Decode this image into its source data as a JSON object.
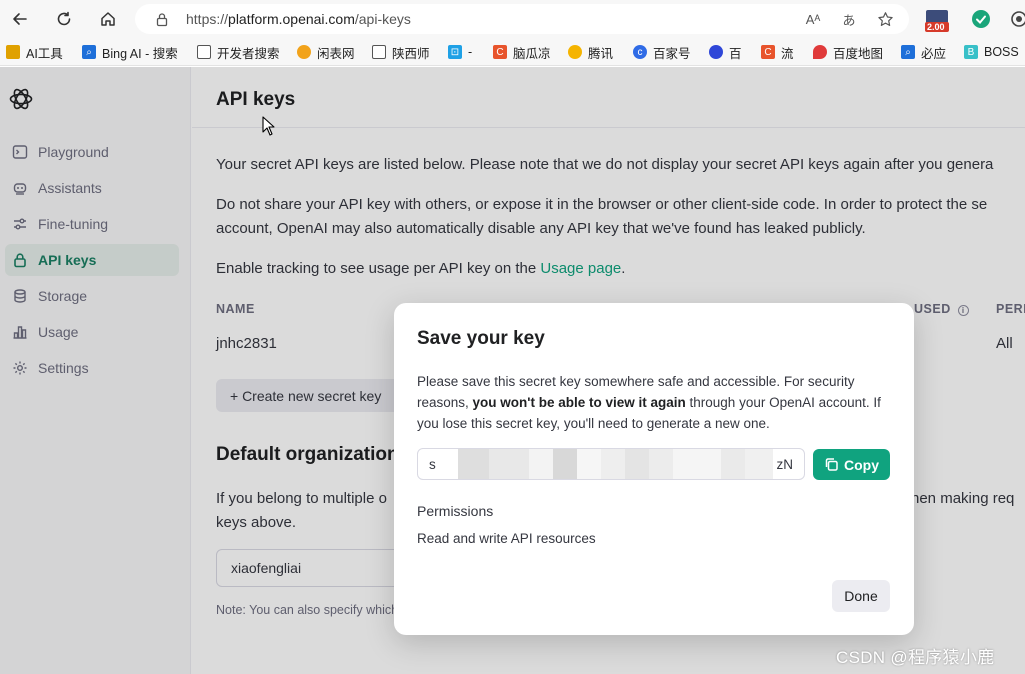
{
  "browser": {
    "url_prefix": "https://",
    "url_host": "platform.openai.com",
    "url_path": "/api-keys",
    "read_aloud": "Aᴬ",
    "translate": "あ",
    "extension_badge": "2.00",
    "bookmarks": [
      {
        "label": "AI工具",
        "color": "#e0a100",
        "icon": "folder-icon"
      },
      {
        "label": "Bing AI - 搜索",
        "color": "#1e6fd9",
        "icon": "search-icon"
      },
      {
        "label": "开发者搜索",
        "color": "#555555",
        "icon": "page-icon"
      },
      {
        "label": "闲表网",
        "color": "#f2a31b",
        "icon": "fruit-icon"
      },
      {
        "label": "陕西师",
        "color": "#555555",
        "icon": "page-icon"
      },
      {
        "label": "-",
        "color": "#1fa1e6",
        "icon": "bilibili-icon"
      },
      {
        "label": "脑瓜凉",
        "color": "#e8542c",
        "icon": "c-icon"
      },
      {
        "label": "腾讯",
        "color": "#f5b400",
        "icon": "bell-icon"
      },
      {
        "label": "百家号",
        "color": "#2f6be6",
        "icon": "baijia-icon"
      },
      {
        "label": "百",
        "color": "#2f47d8",
        "icon": "paw-icon"
      },
      {
        "label": "流",
        "color": "#e8542c",
        "icon": "c-icon"
      },
      {
        "label": "百度地图",
        "color": "#e03a3a",
        "icon": "pin-icon"
      },
      {
        "label": "必应",
        "color": "#1e6fd9",
        "icon": "search-icon"
      },
      {
        "label": "BOSS",
        "color": "#38c0c8",
        "icon": "b-icon"
      }
    ]
  },
  "sidebar": {
    "items": [
      {
        "label": "Playground",
        "icon": "terminal-icon"
      },
      {
        "label": "Assistants",
        "icon": "robot-icon"
      },
      {
        "label": "Fine-tuning",
        "icon": "sliders-icon"
      },
      {
        "label": "API keys",
        "icon": "lock-icon",
        "active": true
      },
      {
        "label": "Storage",
        "icon": "database-icon"
      },
      {
        "label": "Usage",
        "icon": "bar-chart-icon"
      },
      {
        "label": "Settings",
        "icon": "gear-icon"
      }
    ]
  },
  "main": {
    "title": "API keys",
    "intro": "Your secret API keys are listed below. Please note that we do not display your secret API keys again after you genera",
    "warning_line1": "Do not share your API key with others, or expose it in the browser or other client-side code. In order to protect the se",
    "warning_line2": "account, OpenAI may also automatically disable any API key that we've found has leaked publicly.",
    "tracking_text": "Enable tracking to see usage per API key on the ",
    "tracking_link": "Usage page",
    "tracking_end": ".",
    "table": {
      "headers": {
        "name": "NAME",
        "last_used": "USED",
        "permissions": "PERI"
      },
      "rows": [
        {
          "name": "jnhc2831",
          "last_used": "-",
          "permissions": "All"
        }
      ]
    },
    "create_button": "+ Create new secret key",
    "default_org_title": "Default organization",
    "default_org_text_left": "If you belong to multiple o",
    "default_org_text_right": "hen making req",
    "default_org_text_line2": "keys above.",
    "org_value": "xiaofengliai",
    "note": "Note: You can also specify which"
  },
  "modal": {
    "title": "Save your key",
    "text_before": "Please save this secret key somewhere safe and accessible. For security reasons, ",
    "text_bold": "you won't be able to view it again",
    "text_after": " through your OpenAI account. If you lose this secret key, you'll need to generate a new one.",
    "key_start": "s",
    "key_end": "zN",
    "copy_label": "Copy",
    "permissions_label": "Permissions",
    "permissions_value": "Read and write API resources",
    "done_label": "Done"
  },
  "watermark": "CSDN @程序猿小鹿"
}
